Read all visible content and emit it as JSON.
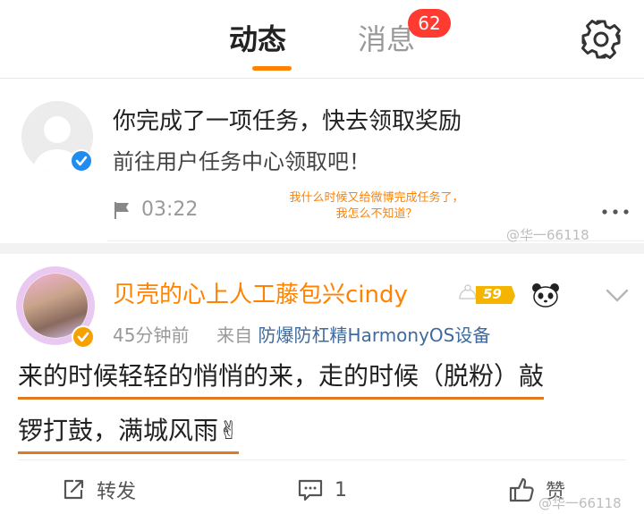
{
  "header": {
    "tab_active": "动态",
    "tab_inactive": "消息",
    "badge_count": "62",
    "accent_color": "#ff8200",
    "settings_icon": "gear-icon"
  },
  "notification": {
    "title": "你完成了一项任务，快去领取奖励",
    "subtitle": "前往用户任务中心领取吧！",
    "time": "03:22",
    "annotation_line1": "我什么时候又给微博完成任务了，",
    "annotation_line2": "我怎么不知道？"
  },
  "watermark": "@华一66118",
  "post": {
    "username": "贝壳的心上人工藤包兴cindy",
    "level": "59",
    "time_ago": "45分钟前",
    "from_label": "来自",
    "source": "防爆防杠精HarmonyOS设备",
    "content_line1": "来的时候轻轻的悄悄的来，走的时候（脱粉）敲",
    "content_line2": "锣打鼓，满城风雨✌",
    "actions": {
      "forward_label": "转发",
      "comment_count": "1",
      "like_label": "赞"
    }
  }
}
